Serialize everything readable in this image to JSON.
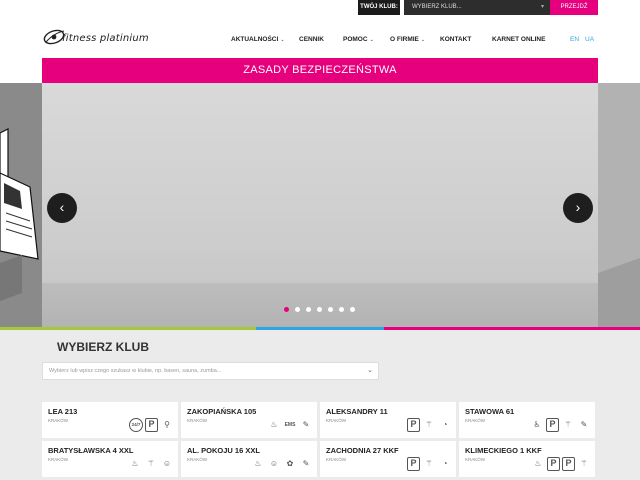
{
  "topbar": {
    "club_label": "TWÓJ KLUB:",
    "club_select_value": "WYBIERZ KLUB...",
    "go_button": "PRZEJDŹ"
  },
  "header": {
    "logo_text": "fitness platinium",
    "nav": [
      {
        "label": "AKTUALNOŚCI",
        "has_dropdown": true
      },
      {
        "label": "CENNIK",
        "has_dropdown": false
      },
      {
        "label": "POMOC",
        "has_dropdown": true
      },
      {
        "label": "O FIRMIE",
        "has_dropdown": true
      },
      {
        "label": "KONTAKT",
        "has_dropdown": false
      },
      {
        "label": "KARNET ONLINE",
        "has_dropdown": false
      }
    ],
    "languages": [
      "EN",
      "UA"
    ]
  },
  "banner": {
    "title": "ZASADY BEZPIECZEŃSTWA",
    "prev_icon": "chevron-left-icon",
    "next_icon": "chevron-right-icon",
    "slides_count": 7,
    "active_slide": 1
  },
  "colors": {
    "accent_pink": "#e6007e",
    "accent_blue": "#2aa7df",
    "accent_green": "#a3c93a"
  },
  "picker": {
    "title": "WYBIERZ KLUB",
    "search_placeholder": "Wybierz lub wpisz czego szukasz w klubie, np. basen, sauna, zumba...",
    "clubs": [
      {
        "name": "LEA 213",
        "city": "KRAKÓW",
        "icons": [
          {
            "type": "c",
            "text": "24/7"
          },
          {
            "type": "p",
            "text": "P"
          },
          {
            "type": "g",
            "text": "⚲"
          }
        ]
      },
      {
        "name": "ZAKOPIAŃSKA 105",
        "city": "KRAKÓW",
        "icons": [
          {
            "type": "g",
            "text": "♨"
          },
          {
            "type": "t",
            "text": "EMS"
          },
          {
            "type": "g",
            "text": "✎"
          }
        ]
      },
      {
        "name": "ALEKSANDRY 11",
        "city": "KRAKÓW",
        "icons": [
          {
            "type": "p",
            "text": "P"
          },
          {
            "type": "g",
            "text": "⚚"
          },
          {
            "type": "g",
            "text": "◔"
          }
        ]
      },
      {
        "name": "STAWOWA 61",
        "city": "KRAKÓW",
        "icons": [
          {
            "type": "g",
            "text": "♿"
          },
          {
            "type": "p",
            "text": "P"
          },
          {
            "type": "g",
            "text": "⚚"
          },
          {
            "type": "g",
            "text": "✎"
          }
        ]
      },
      {
        "name": "BRATYSŁAWSKA 4 XXL",
        "city": "KRAKÓW",
        "icons": [
          {
            "type": "g",
            "text": "♨"
          },
          {
            "type": "g",
            "text": "⚚"
          },
          {
            "type": "g",
            "text": "☺"
          }
        ]
      },
      {
        "name": "AL. POKOJU 16 XXL",
        "city": "KRAKÓW",
        "icons": [
          {
            "type": "g",
            "text": "♨"
          },
          {
            "type": "g",
            "text": "☺"
          },
          {
            "type": "g",
            "text": "✿"
          },
          {
            "type": "g",
            "text": "✎"
          }
        ]
      },
      {
        "name": "ZACHODNIA 27 KKF",
        "city": "KRAKÓW",
        "icons": [
          {
            "type": "p",
            "text": "P"
          },
          {
            "type": "g",
            "text": "⚚"
          },
          {
            "type": "g",
            "text": "◔"
          }
        ]
      },
      {
        "name": "KLIMECKIEGO 1 KKF",
        "city": "KRAKÓW",
        "icons": [
          {
            "type": "g",
            "text": "♨"
          },
          {
            "type": "p",
            "text": "P"
          },
          {
            "type": "p",
            "text": "P"
          },
          {
            "type": "g",
            "text": "⚚"
          }
        ]
      }
    ]
  }
}
